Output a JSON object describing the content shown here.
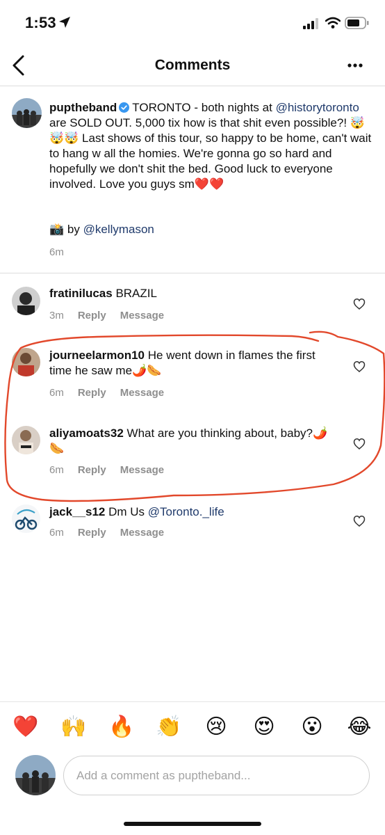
{
  "status_bar": {
    "time": "1:53"
  },
  "nav": {
    "title": "Comments"
  },
  "caption": {
    "username": "puptheband",
    "verified": true,
    "part1": "TORONTO - both nights at ",
    "mention": "@historytoronto",
    "part2": " are SOLD OUT. 5,000 tix how is that shit even possible?! 🤯🤯🤯 Last shows of this tour, so happy to be home, can't wait to hang w all the homies. We're gonna go so hard and hopefully we don't shit the bed. Good luck to everyone involved. Love you guys sm❤️❤️",
    "credit_prefix": "📸 by ",
    "credit_mention": "@kellymason",
    "time": "6m"
  },
  "comments": [
    {
      "username": "fratinilucas",
      "text": "BRAZIL",
      "mention": "",
      "time": "3m",
      "reply": "Reply",
      "message": "Message"
    },
    {
      "username": "journeelarmon10",
      "text": "He went down in flames the first time he saw me🌶️🌭",
      "mention": "",
      "time": "6m",
      "reply": "Reply",
      "message": "Message"
    },
    {
      "username": "aliyamoats32",
      "text": "What are you thinking about, baby?🌶️🌭",
      "mention": "",
      "time": "6m",
      "reply": "Reply",
      "message": "Message"
    },
    {
      "username": "jack__s12",
      "text": "Dm Us ",
      "mention": "@Toronto._life",
      "time": "6m",
      "reply": "Reply",
      "message": "Message"
    }
  ],
  "reactions": [
    "❤️",
    "🙌",
    "🔥",
    "👏",
    "😢",
    "😍",
    "😮",
    "😂"
  ],
  "comment_input": {
    "placeholder": "Add a comment as puptheband..."
  },
  "colors": {
    "link": "#1f3a6b",
    "annotation": "#e2482b",
    "verified": "#3897f0",
    "meta": "#8e8e8e"
  }
}
